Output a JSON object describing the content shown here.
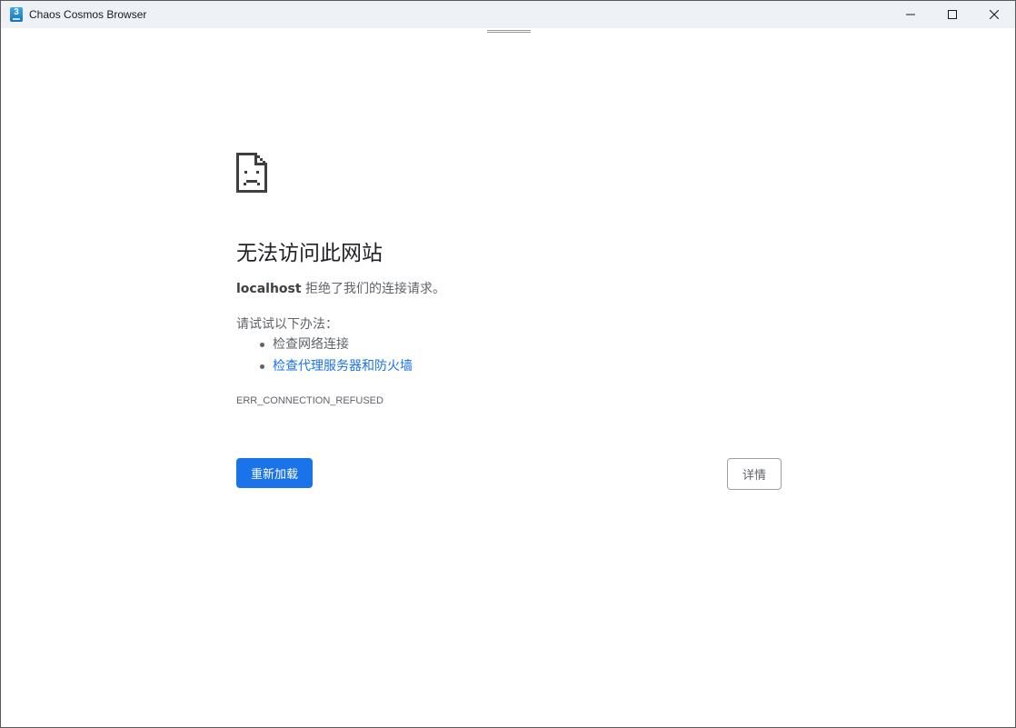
{
  "window": {
    "title": "Chaos Cosmos Browser",
    "app_icon_label": "3",
    "controls": {
      "minimize": "minimize-icon",
      "maximize": "maximize-icon",
      "close": "close-icon"
    }
  },
  "error_page": {
    "icon": "sad-document-icon",
    "heading": "无法访问此网站",
    "host": "localhost",
    "message": "拒绝了我们的连接请求。",
    "try_label": "请试试以下办法：",
    "suggestions": [
      {
        "label": "检查网络连接",
        "is_link": false
      },
      {
        "label": "检查代理服务器和防火墙",
        "is_link": true
      }
    ],
    "error_code": "ERR_CONNECTION_REFUSED",
    "reload_label": "重新加载",
    "details_label": "详情"
  },
  "colors": {
    "accent": "#1a73e8",
    "text_primary": "#202124",
    "text_secondary": "#5f6368",
    "titlebar": "#eef1f6"
  }
}
